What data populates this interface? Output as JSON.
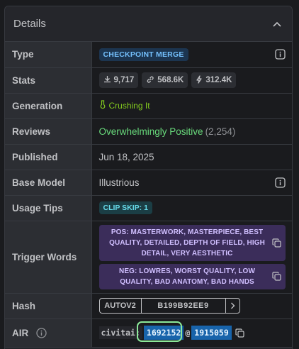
{
  "header": {
    "title": "Details"
  },
  "rows": {
    "type": {
      "label": "Type",
      "badge": "CHECKPOINT MERGE"
    },
    "stats": {
      "label": "Stats",
      "downloads": "9,717",
      "generations": "568.6K",
      "buzz": "312.4K"
    },
    "generation": {
      "label": "Generation",
      "value": "Crushing It"
    },
    "reviews": {
      "label": "Reviews",
      "value": "Overwhelmingly Positive",
      "count": "(2,254)"
    },
    "published": {
      "label": "Published",
      "value": "Jun 18, 2025"
    },
    "base_model": {
      "label": "Base Model",
      "value": "Illustrious"
    },
    "usage_tips": {
      "label": "Usage Tips",
      "badge": "CLIP SKIP: 1"
    },
    "trigger_words": {
      "label": "Trigger Words",
      "pos": "POS: MASTERWORK, MASTERPIECE, BEST QUALITY, DETAILED, DEPTH OF FIELD, HIGH DETAIL, VERY AESTHETIC",
      "neg": "NEG: LOWRES, WORST QUALITY, LOW QUALITY, BAD ANATOMY, BAD HANDS"
    },
    "hash": {
      "label": "Hash",
      "type": "AUTOV2",
      "value": "B199B92EE9"
    },
    "air": {
      "label": "AIR",
      "prefix": "civitai:",
      "model_id": "1692152",
      "at": "@",
      "version_id": "1915059"
    }
  },
  "colors": {
    "type_badge": "#74c0fc",
    "reviews": "#69db7c",
    "generation": "#82c91e",
    "trigger_bg": "#3b2d5a",
    "air_id_bg": "#1864ab",
    "highlight": "#8ce99a"
  },
  "icons": [
    "chevron-up-icon",
    "info-icon",
    "download-icon",
    "link-icon",
    "bolt-icon",
    "flask-icon",
    "copy-icon",
    "chevron-right-icon"
  ]
}
